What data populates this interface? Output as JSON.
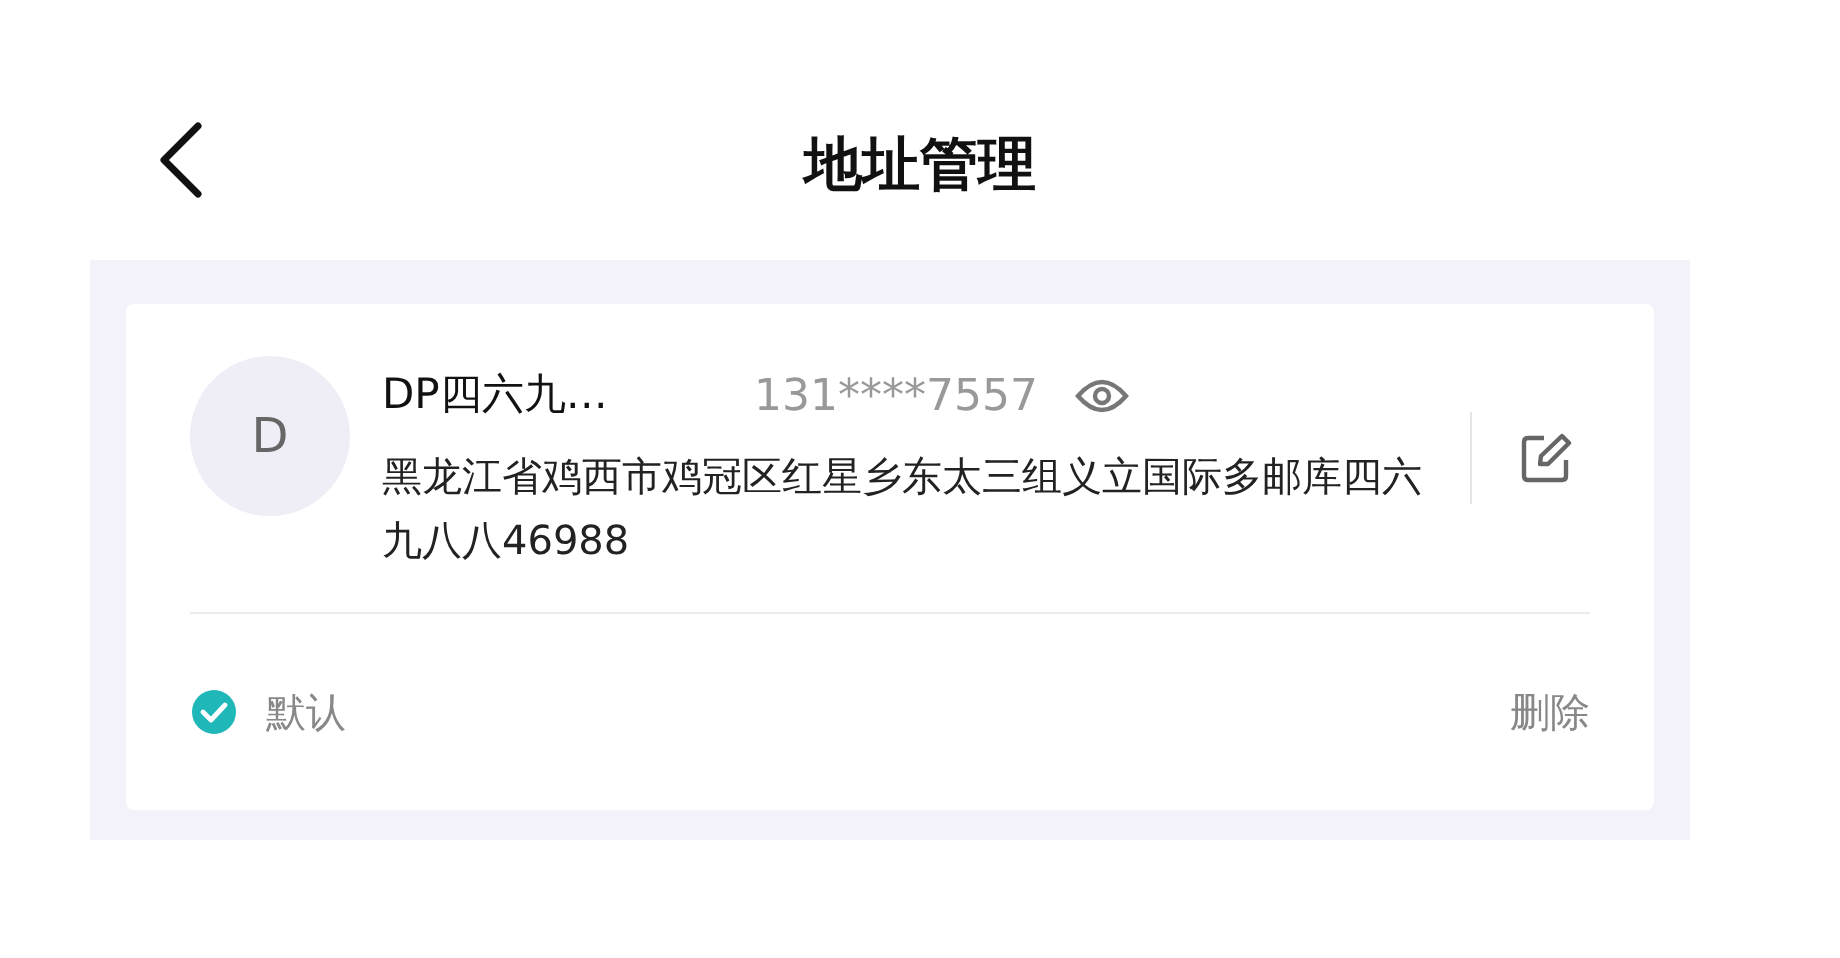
{
  "header": {
    "title": "地址管理"
  },
  "addresses": [
    {
      "avatar": "D",
      "name": "DP四六九…",
      "phone": "131****7557",
      "address": "黑龙江省鸡西市鸡冠区红星乡东太三组义立国际多邮库四六九八八46988",
      "default": {
        "label": "默认",
        "checked": true
      },
      "delete": "删除"
    }
  ]
}
